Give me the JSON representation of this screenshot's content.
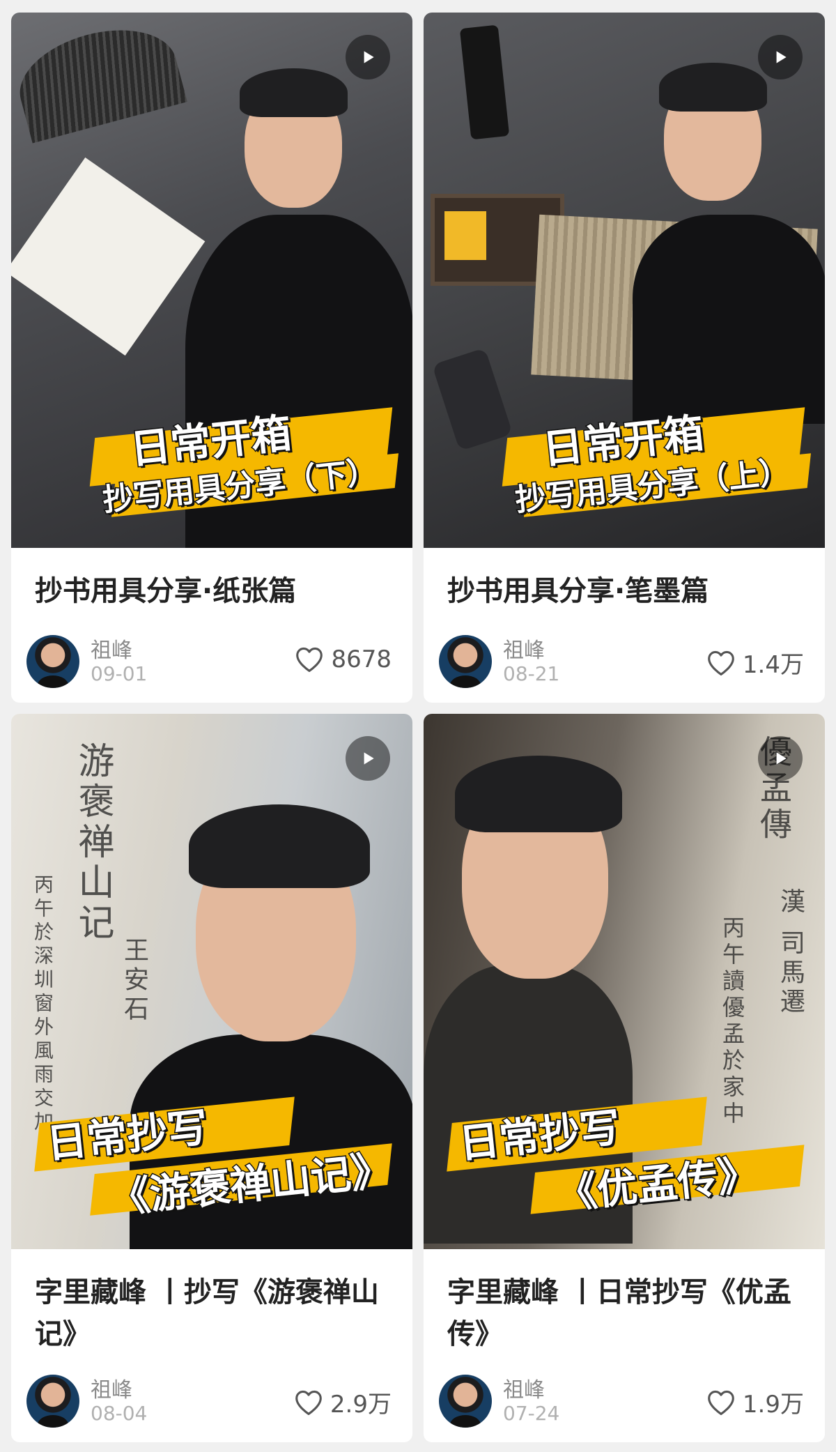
{
  "cards": [
    {
      "overlay_line1": "日常开箱",
      "overlay_line2": "抄写用具分享（下）",
      "title": "抄书用具分享·纸张篇",
      "author": "祖峰",
      "date": "09-01",
      "likes": "8678"
    },
    {
      "overlay_line1": "日常开箱",
      "overlay_line2": "抄写用具分享（上）",
      "title": "抄书用具分享·笔墨篇",
      "author": "祖峰",
      "date": "08-21",
      "likes": "1.4万"
    },
    {
      "overlay_line1": "日常抄写",
      "overlay_line2": "《游褒禅山记》",
      "title": "字里藏峰 丨抄写《游褒禅山记》",
      "author": "祖峰",
      "date": "08-04",
      "likes": "2.9万",
      "calligraphy": [
        "游褒禅山记",
        "王安石",
        "丙午於深圳窗外風雨交加"
      ]
    },
    {
      "overlay_line1": "日常抄写",
      "overlay_line2": "《优孟传》",
      "title": "字里藏峰 丨日常抄写《优孟传》",
      "author": "祖峰",
      "date": "07-24",
      "likes": "1.9万",
      "calligraphy": [
        "優孟傳",
        "漢 司馬遷",
        "丙午讀優孟於家中"
      ]
    }
  ],
  "icons": {
    "play": "play-icon",
    "like": "heart-outline-icon"
  },
  "colors": {
    "accent_stripe": "#f5b800",
    "title_text": "#222222",
    "meta_text": "#8a8a8a",
    "page_bg": "#f0f0f0"
  }
}
